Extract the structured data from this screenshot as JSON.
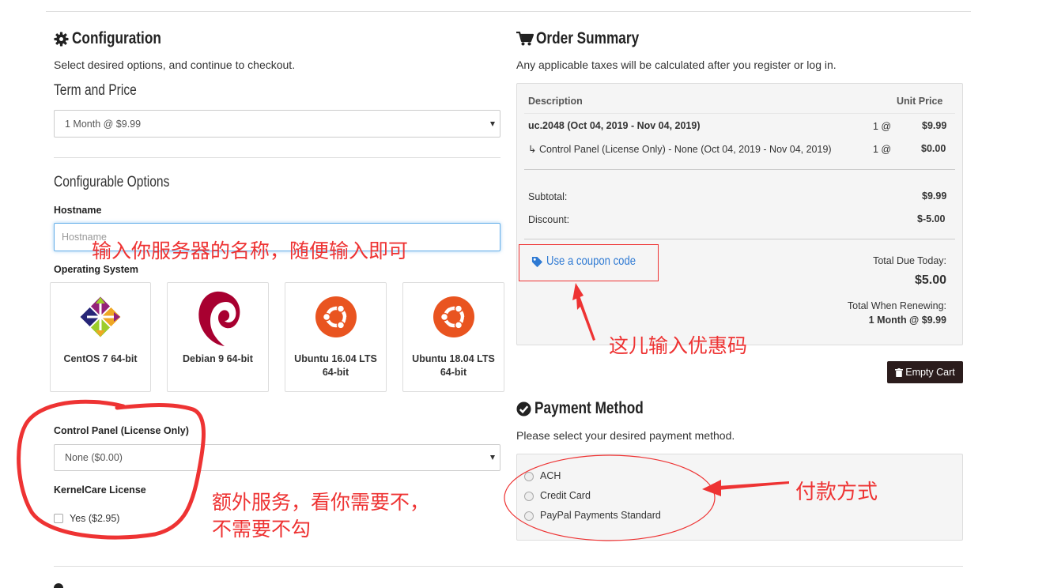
{
  "config": {
    "heading": "Configuration",
    "subtitle": "Select desired options, and continue to checkout.",
    "term_heading": "Term and Price",
    "term_value": "1 Month @ $9.99",
    "options_heading": "Configurable Options",
    "hostname_label": "Hostname",
    "hostname_placeholder": "Hostname",
    "os_label": "Operating System",
    "os_cards": [
      {
        "name": "CentOS 7 64-bit",
        "icon": "centos-logo-icon"
      },
      {
        "name": "Debian 9 64-bit",
        "icon": "debian-logo-icon"
      },
      {
        "name": "Ubuntu 16.04 LTS 64-bit",
        "icon": "ubuntu-logo-icon"
      },
      {
        "name": "Ubuntu 18.04 LTS 64-bit",
        "icon": "ubuntu-logo-icon"
      }
    ],
    "control_panel_label": "Control Panel (License Only)",
    "control_panel_value": "None ($0.00)",
    "kernelcare_label": "KernelCare License",
    "kernelcare_option": "Yes ($2.95)"
  },
  "summary": {
    "heading": "Order Summary",
    "subtitle": "Any applicable taxes will be calculated after you register or log in.",
    "col_description": "Description",
    "col_unit_price": "Unit Price",
    "items": [
      {
        "desc": "uc.2048 (Oct 04, 2019 - Nov 04, 2019)",
        "qty": "1 @",
        "price": "$9.99"
      },
      {
        "desc": "↳ Control Panel (License Only) - None (Oct 04, 2019 - Nov 04, 2019)",
        "qty": "1 @",
        "price": "$0.00"
      }
    ],
    "subtotal_label": "Subtotal:",
    "subtotal_value": "$9.99",
    "discount_label": "Discount:",
    "discount_value": "$-5.00",
    "coupon_link": "Use a coupon code",
    "total_due_label": "Total Due Today:",
    "total_due_value": "$5.00",
    "renew_label": "Total When Renewing:",
    "renew_value": "1 Month @ $9.99",
    "empty_cart": "Empty Cart"
  },
  "payment": {
    "heading": "Payment Method",
    "subtitle": "Please select your desired payment method.",
    "methods": [
      "ACH",
      "Credit Card",
      "PayPal Payments Standard"
    ]
  },
  "annotations": {
    "hostname_note": "输入你服务器的名称，随便输入即可",
    "coupon_note": "这儿输入优惠码",
    "extras_note_1": "额外服务，看你需要不，",
    "extras_note_2": "不需要不勾",
    "payment_note": "付款方式"
  },
  "colors": {
    "annotation_red": "#e33333",
    "link_blue": "#2f7ad3",
    "dark_button": "#2b1c1c",
    "ubuntu_orange": "#e95420",
    "debian_red": "#a80030"
  }
}
